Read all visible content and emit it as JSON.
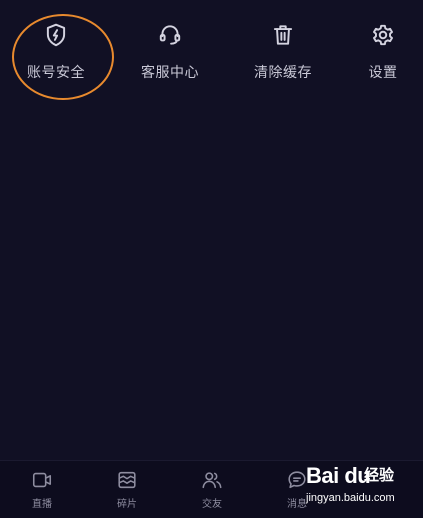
{
  "quick_actions": [
    {
      "label": "账号安全",
      "icon": "shield-lightning-icon"
    },
    {
      "label": "客服中心",
      "icon": "headset-icon"
    },
    {
      "label": "清除缓存",
      "icon": "trash-icon"
    },
    {
      "label": "设置",
      "icon": "gear-icon"
    }
  ],
  "tabbar": {
    "items": [
      {
        "label": "直播",
        "icon": "live-camera-icon"
      },
      {
        "label": "碎片",
        "icon": "fragments-icon"
      },
      {
        "label": "交友",
        "icon": "friends-icon"
      },
      {
        "label": "消息",
        "icon": "message-icon"
      }
    ]
  },
  "watermark": {
    "brand": "Bai du",
    "suffix": "经验",
    "url": "jingyan.baidu.com"
  },
  "colors": {
    "background": "#111024",
    "tabbar_background": "#0d0c1e",
    "label": "#c9c8d6",
    "tab_label": "#8e8da0",
    "annotation": "#e88a2e"
  }
}
